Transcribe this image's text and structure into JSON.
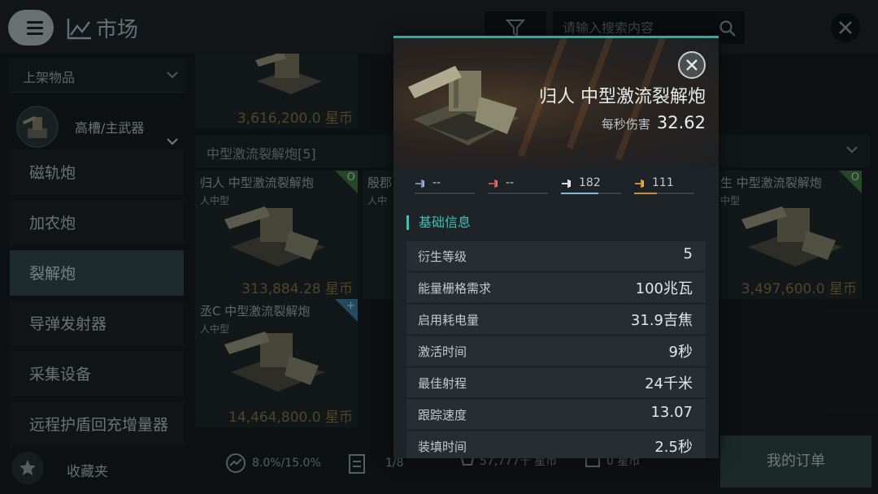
{
  "header": {
    "title": "市场",
    "search_placeholder": "请输入搜索内容"
  },
  "sidebar": {
    "listed_label": "上架物品",
    "category_label": "高槽/主武器",
    "items": [
      {
        "label": "磁轨炮"
      },
      {
        "label": "加农炮"
      },
      {
        "label": "裂解炮"
      },
      {
        "label": "导弹发射器"
      },
      {
        "label": "采集设备"
      },
      {
        "label": "远程护盾回充增量器"
      }
    ],
    "favorites_label": "收藏夹"
  },
  "grid": {
    "top_card_price": "3,616,200.0 星币",
    "section_title": "中型激流裂解炮[5]",
    "cards": [
      {
        "name": "归人 中型激流裂解炮",
        "sub": "人中型",
        "price": "313,884.28 星币",
        "badge": "O"
      },
      {
        "name": "殷郡",
        "sub": "人中",
        "price": "",
        "badge": ""
      },
      {
        "name": "生 中型激流裂解炮",
        "sub": "中型",
        "price": "3,497,600.0 星币",
        "badge": "O"
      },
      {
        "name": "丞C 中型激流裂解炮",
        "sub": "人中型",
        "price": "14,464,800.0 星币",
        "badge": "+"
      }
    ]
  },
  "bottombar": {
    "tax": "8.0%/15.0%",
    "orders_count": "1/8",
    "buy_total": "57,777千 星币",
    "sell_total": "0 星币",
    "my_orders": "我的订单"
  },
  "popup": {
    "item_name": "归人 中型激流裂解炮",
    "dps_label": "每秒伤害",
    "dps_value": "32.62",
    "damage": [
      {
        "value": "--",
        "fill": 0,
        "color": "#6f8fb0"
      },
      {
        "value": "--",
        "fill": 0,
        "color": "#c0504a"
      },
      {
        "value": "182",
        "fill": 0.62,
        "color": "#7fb7d6"
      },
      {
        "value": "111",
        "fill": 0.38,
        "color": "#c9902f"
      }
    ],
    "section_title": "基础信息",
    "attributes": [
      {
        "key": "衍生等级",
        "value": "5"
      },
      {
        "key": "能量栅格需求",
        "value": "100兆瓦"
      },
      {
        "key": "启用耗电量",
        "value": "31.9吉焦"
      },
      {
        "key": "激活时间",
        "value": "9秒"
      },
      {
        "key": "最佳射程",
        "value": "24千米"
      },
      {
        "key": "跟踪速度",
        "value": "13.07"
      },
      {
        "key": "装填时间",
        "value": "2.5秒"
      }
    ]
  }
}
